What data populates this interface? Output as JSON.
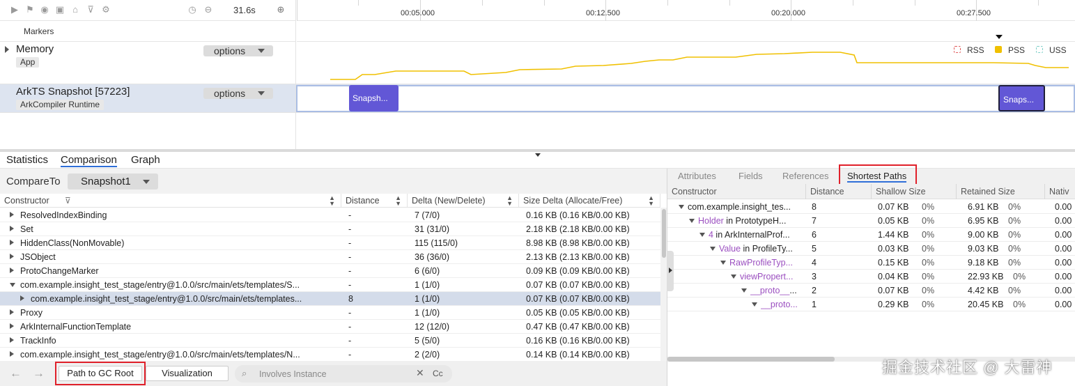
{
  "toolbar": {
    "icons": [
      "play-icon",
      "flag-icon",
      "record-icon",
      "camera-icon",
      "capture-icon",
      "filter-icon",
      "settings-icon"
    ],
    "duration": "31.6s"
  },
  "timeline": {
    "markers_label": "Markers",
    "ticks": [
      "00:05.000",
      "00:12.500",
      "00:20.000",
      "00:27.500"
    ]
  },
  "lanes": {
    "memory": {
      "title": "Memory",
      "badge": "App",
      "options": "options"
    },
    "ark": {
      "title": "ArkTS Snapshot [57223]",
      "badge": "ArkCompiler Runtime",
      "options": "options"
    }
  },
  "legend": [
    {
      "label": "RSS",
      "color": "#e05a5a",
      "filled": false
    },
    {
      "label": "PSS",
      "color": "#f0c000",
      "filled": true
    },
    {
      "label": "USS",
      "color": "#7ecfc8",
      "filled": false
    }
  ],
  "snapshots": [
    {
      "label": "Snapsh...",
      "selected": false
    },
    {
      "label": "Snaps...",
      "selected": true
    }
  ],
  "main_tabs": [
    {
      "label": "Statistics",
      "active": false
    },
    {
      "label": "Comparison",
      "active": true
    },
    {
      "label": "Graph",
      "active": false
    }
  ],
  "compare": {
    "label": "CompareTo",
    "selected": "Snapshot1"
  },
  "table": {
    "columns": [
      "Constructor",
      "Distance",
      "Delta (New/Delete)",
      "Size Delta (Allocate/Free)"
    ],
    "rows": [
      {
        "name": "ResolvedIndexBinding",
        "distance": "-",
        "delta": "7 (7/0)",
        "size": "0.16 KB (0.16 KB/0.00 KB)",
        "expand": "right",
        "indent": 0
      },
      {
        "name": "Set",
        "distance": "-",
        "delta": "31 (31/0)",
        "size": "2.18 KB (2.18 KB/0.00 KB)",
        "expand": "right",
        "indent": 0
      },
      {
        "name": "HiddenClass(NonMovable)",
        "distance": "-",
        "delta": "115 (115/0)",
        "size": "8.98 KB (8.98 KB/0.00 KB)",
        "expand": "right",
        "indent": 0
      },
      {
        "name": "JSObject",
        "distance": "-",
        "delta": "36 (36/0)",
        "size": "2.13 KB (2.13 KB/0.00 KB)",
        "expand": "right",
        "indent": 0
      },
      {
        "name": "ProtoChangeMarker",
        "distance": "-",
        "delta": "6 (6/0)",
        "size": "0.09 KB (0.09 KB/0.00 KB)",
        "expand": "right",
        "indent": 0
      },
      {
        "name": "com.example.insight_test_stage/entry@1.0.0/src/main/ets/templates/S...",
        "distance": "-",
        "delta": "1 (1/0)",
        "size": "0.07 KB (0.07 KB/0.00 KB)",
        "expand": "down",
        "indent": 0
      },
      {
        "name": "com.example.insight_test_stage/entry@1.0.0/src/main/ets/templates...",
        "distance": "8",
        "delta": "1 (1/0)",
        "size": "0.07 KB (0.07 KB/0.00 KB)",
        "expand": "right",
        "indent": 1,
        "selected": true
      },
      {
        "name": "Proxy",
        "distance": "-",
        "delta": "1 (1/0)",
        "size": "0.05 KB (0.05 KB/0.00 KB)",
        "expand": "right",
        "indent": 0
      },
      {
        "name": "ArkInternalFunctionTemplate",
        "distance": "-",
        "delta": "12 (12/0)",
        "size": "0.47 KB (0.47 KB/0.00 KB)",
        "expand": "right",
        "indent": 0
      },
      {
        "name": "TrackInfo",
        "distance": "-",
        "delta": "5 (5/0)",
        "size": "0.16 KB (0.16 KB/0.00 KB)",
        "expand": "right",
        "indent": 0
      },
      {
        "name": "com.example.insight_test_stage/entry@1.0.0/src/main/ets/templates/N...",
        "distance": "-",
        "delta": "2 (2/0)",
        "size": "0.14 KB (0.14 KB/0.00 KB)",
        "expand": "right",
        "indent": 0
      }
    ]
  },
  "bottom_bar": {
    "path_button": "Path to GC Root",
    "visualization_button": "Visualization",
    "search_placeholder": "Involves Instance",
    "case_label": "Cc"
  },
  "right": {
    "tabs": [
      {
        "label": "Attributes",
        "active": false
      },
      {
        "label": "Fields",
        "active": false
      },
      {
        "label": "References",
        "active": false
      },
      {
        "label": "Shortest Paths",
        "active": true
      }
    ],
    "columns": [
      "Constructor",
      "Distance",
      "Shallow Size",
      "Retained Size",
      "Nativ"
    ],
    "rows": [
      {
        "prefix": "",
        "key": "com.example.insight_tes...",
        "suffix": "",
        "distance": "8",
        "shallow": "0.07 KB",
        "shallow_pct": "0%",
        "retained": "6.91 KB",
        "retained_pct": "0%",
        "native": "0.00",
        "indent": 0
      },
      {
        "prefix": "",
        "key": "Holder",
        "suffix": " in PrototypeH...",
        "distance": "7",
        "shallow": "0.05 KB",
        "shallow_pct": "0%",
        "retained": "6.95 KB",
        "retained_pct": "0%",
        "native": "0.00",
        "indent": 1
      },
      {
        "prefix": "",
        "key": "4",
        "suffix": " in ArkInternalProf...",
        "distance": "6",
        "shallow": "1.44 KB",
        "shallow_pct": "0%",
        "retained": "9.00 KB",
        "retained_pct": "0%",
        "native": "0.00",
        "indent": 2
      },
      {
        "prefix": "",
        "key": "Value",
        "suffix": " in ProfileTy...",
        "distance": "5",
        "shallow": "0.03 KB",
        "shallow_pct": "0%",
        "retained": "9.03 KB",
        "retained_pct": "0%",
        "native": "0.00",
        "indent": 3
      },
      {
        "prefix": "",
        "key": "RawProfileTyp...",
        "suffix": "",
        "distance": "4",
        "shallow": "0.15 KB",
        "shallow_pct": "0%",
        "retained": "9.18 KB",
        "retained_pct": "0%",
        "native": "0.00",
        "indent": 4
      },
      {
        "prefix": "",
        "key": "viewPropert...",
        "suffix": "",
        "distance": "3",
        "shallow": "0.04 KB",
        "shallow_pct": "0%",
        "retained": "22.93 KB",
        "retained_pct": "0%",
        "native": "0.00",
        "indent": 5
      },
      {
        "prefix": "",
        "key": "__proto__",
        "suffix": "...",
        "distance": "2",
        "shallow": "0.07 KB",
        "shallow_pct": "0%",
        "retained": "4.42 KB",
        "retained_pct": "0%",
        "native": "0.00",
        "indent": 6
      },
      {
        "prefix": "",
        "key": "__proto...",
        "suffix": "",
        "distance": "1",
        "shallow": "0.29 KB",
        "shallow_pct": "0%",
        "retained": "20.45 KB",
        "retained_pct": "0%",
        "native": "0.00",
        "indent": 7
      }
    ]
  },
  "watermark": "掘金技术社区 @ 大雷神"
}
